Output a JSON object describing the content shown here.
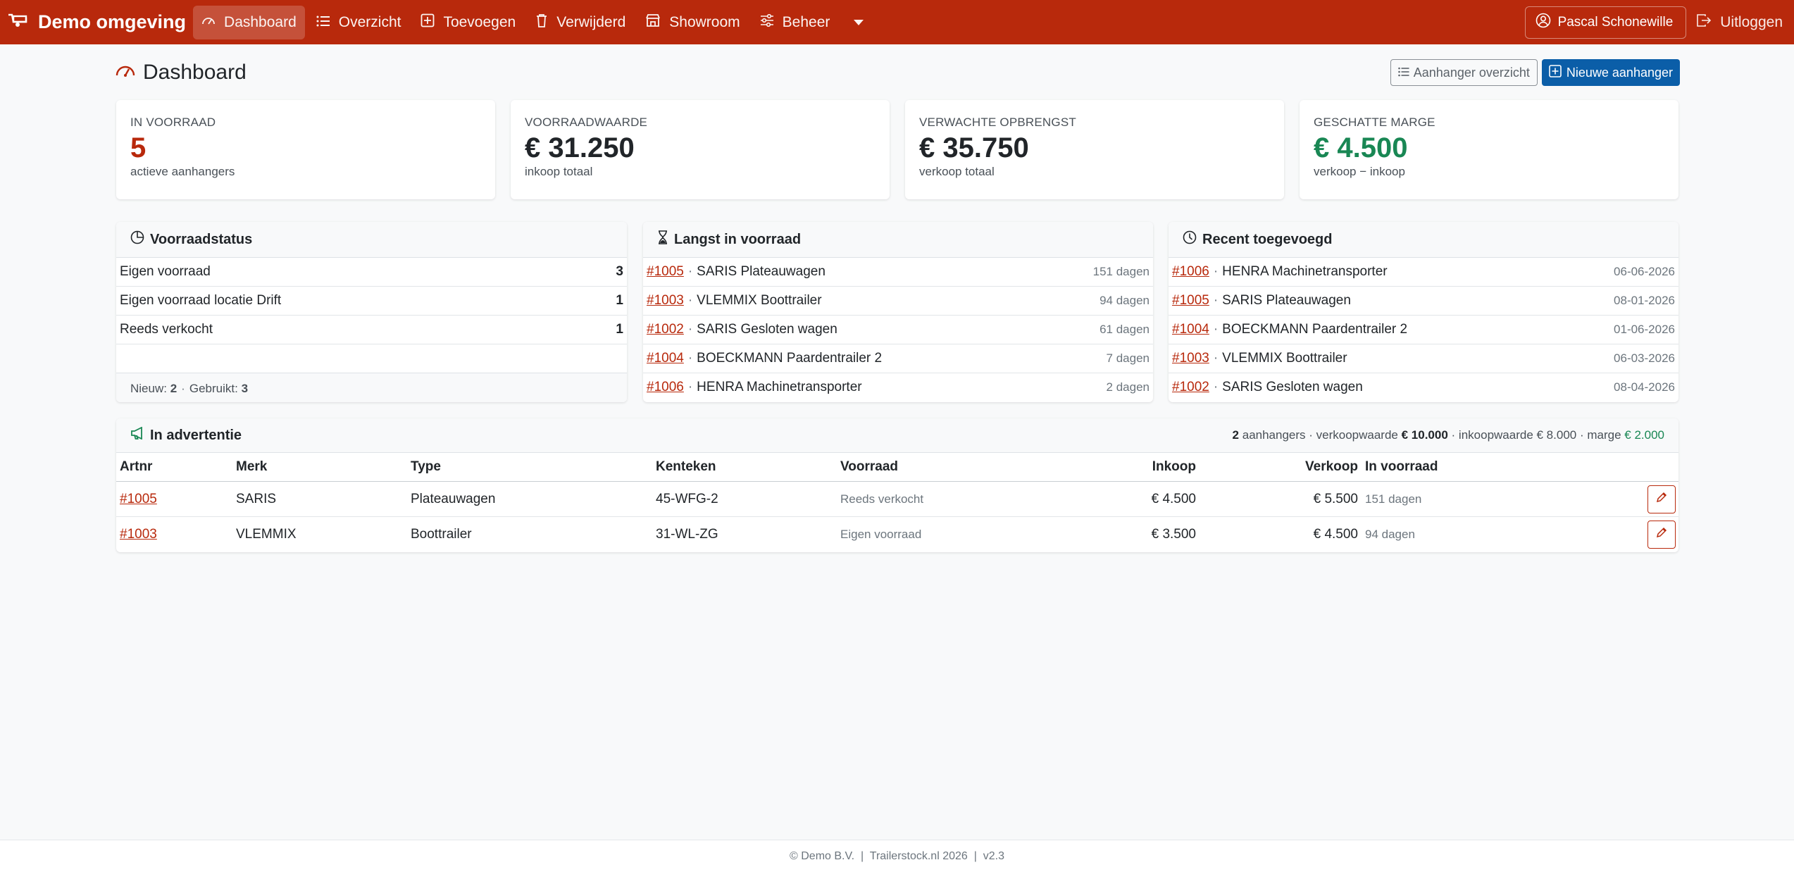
{
  "navbar": {
    "brand": "Demo omgeving",
    "items": [
      {
        "label": "Dashboard",
        "icon": "speedometer-icon",
        "active": true
      },
      {
        "label": "Overzicht",
        "icon": "list-icon"
      },
      {
        "label": "Toevoegen",
        "icon": "plus-square-icon"
      },
      {
        "label": "Verwijderd",
        "icon": "trash-icon"
      },
      {
        "label": "Showroom",
        "icon": "shop-icon"
      },
      {
        "label": "Beheer",
        "icon": "sliders-icon"
      }
    ],
    "user": "Pascal Schonewille",
    "logout": "Uitloggen"
  },
  "header": {
    "title": "Dashboard",
    "overview_btn": "Aanhanger overzicht",
    "new_btn": "Nieuwe aanhanger"
  },
  "stats": [
    {
      "label": "IN VOORRAAD",
      "value": "5",
      "sub": "actieve aanhangers",
      "color": "#b8290c"
    },
    {
      "label": "VOORRAADWAARDE",
      "value": "€ 31.250",
      "sub": "inkoop totaal",
      "color": "#212529"
    },
    {
      "label": "VERWACHTE OPBRENGST",
      "value": "€ 35.750",
      "sub": "verkoop totaal",
      "color": "#212529"
    },
    {
      "label": "GESCHATTE MARGE",
      "value": "€ 4.500",
      "sub": "verkoop − inkoop",
      "color": "#198754"
    }
  ],
  "voorraadstatus": {
    "title": "Voorraadstatus",
    "rows": [
      {
        "label": "Eigen voorraad",
        "count": "3"
      },
      {
        "label": "Eigen voorraad locatie Drift",
        "count": "1"
      },
      {
        "label": "Reeds verkocht",
        "count": "1"
      }
    ],
    "footer_new_label": "Nieuw:",
    "footer_new": "2",
    "footer_used_label": "Gebruikt:",
    "footer_used": "3"
  },
  "langst": {
    "title": "Langst in voorraad",
    "rows": [
      {
        "id": "#1005",
        "name": "SARIS Plateauwagen",
        "days": "151 dagen"
      },
      {
        "id": "#1003",
        "name": "VLEMMIX Boottrailer",
        "days": "94 dagen"
      },
      {
        "id": "#1002",
        "name": "SARIS Gesloten wagen",
        "days": "61 dagen"
      },
      {
        "id": "#1004",
        "name": "BOECKMANN Paardentrailer 2",
        "days": "7 dagen"
      },
      {
        "id": "#1006",
        "name": "HENRA Machinetransporter",
        "days": "2 dagen"
      }
    ]
  },
  "recent": {
    "title": "Recent toegevoegd",
    "rows": [
      {
        "id": "#1006",
        "name": "HENRA Machinetransporter",
        "date": "06-06-2026"
      },
      {
        "id": "#1005",
        "name": "SARIS Plateauwagen",
        "date": "08-01-2026"
      },
      {
        "id": "#1004",
        "name": "BOECKMANN Paardentrailer 2",
        "date": "01-06-2026"
      },
      {
        "id": "#1003",
        "name": "VLEMMIX Boottrailer",
        "date": "06-03-2026"
      },
      {
        "id": "#1002",
        "name": "SARIS Gesloten wagen",
        "date": "08-04-2026"
      }
    ]
  },
  "ads": {
    "title": "In advertentie",
    "summary": {
      "count": "2",
      "count_label": "aanhangers · verkoopwaarde",
      "sale_value": "€ 10.000",
      "buy_label": "· inkoopwaarde € 8.000 · marge",
      "margin": "€ 2.000"
    },
    "columns": [
      "Artnr",
      "Merk",
      "Type",
      "Kenteken",
      "Voorraad",
      "Inkoop",
      "Verkoop",
      "In voorraad"
    ],
    "rows": [
      {
        "artnr": "#1005",
        "merk": "SARIS",
        "type": "Plateauwagen",
        "kenteken": "45-WFG-2",
        "voorraad": "Reeds verkocht",
        "inkoop": "€ 4.500",
        "verkoop": "€ 5.500",
        "dagen": "151 dagen"
      },
      {
        "artnr": "#1003",
        "merk": "VLEMMIX",
        "type": "Boottrailer",
        "kenteken": "31-WL-ZG",
        "voorraad": "Eigen voorraad",
        "inkoop": "€ 3.500",
        "verkoop": "€ 4.500",
        "dagen": "94 dagen"
      }
    ]
  },
  "footer": "© Demo B.V.  |  Trailerstock.nl 2026  |  v2.3"
}
